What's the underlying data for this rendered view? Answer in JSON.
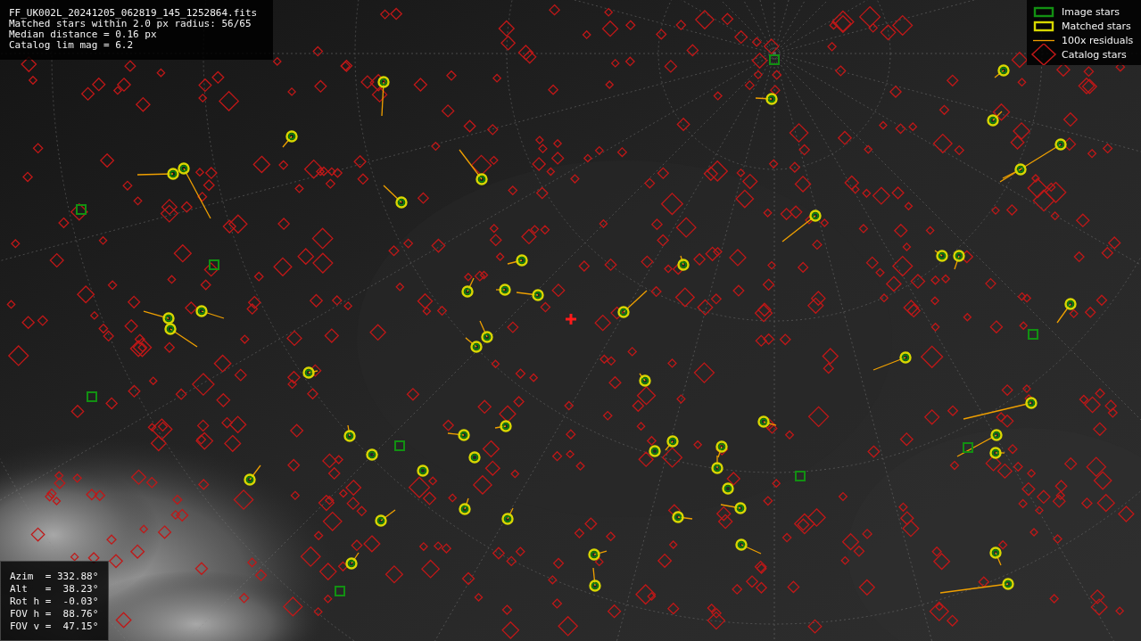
{
  "info_box": {
    "lines": [
      "FF_UK002L_20241205_062819_145_1252864.fits",
      "Matched stars within 2.0 px radius: 56/65",
      "Median distance = 0.16 px",
      "Catalog lim mag = 6.2"
    ]
  },
  "legend": [
    {
      "label": "Image stars"
    },
    {
      "kind": "matched",
      "label": "Matched stars"
    },
    {
      "kind": "residual",
      "label": "100x residuals"
    },
    {
      "kind": "catalog",
      "label": "Catalog stars"
    }
  ],
  "pointing": {
    "lines": [
      "Azim  = 332.88°",
      "Alt   =  38.23°",
      "Rot h =  -0.03°",
      "FOV h =  88.76°",
      "FOV v =  47.15°"
    ]
  }
}
